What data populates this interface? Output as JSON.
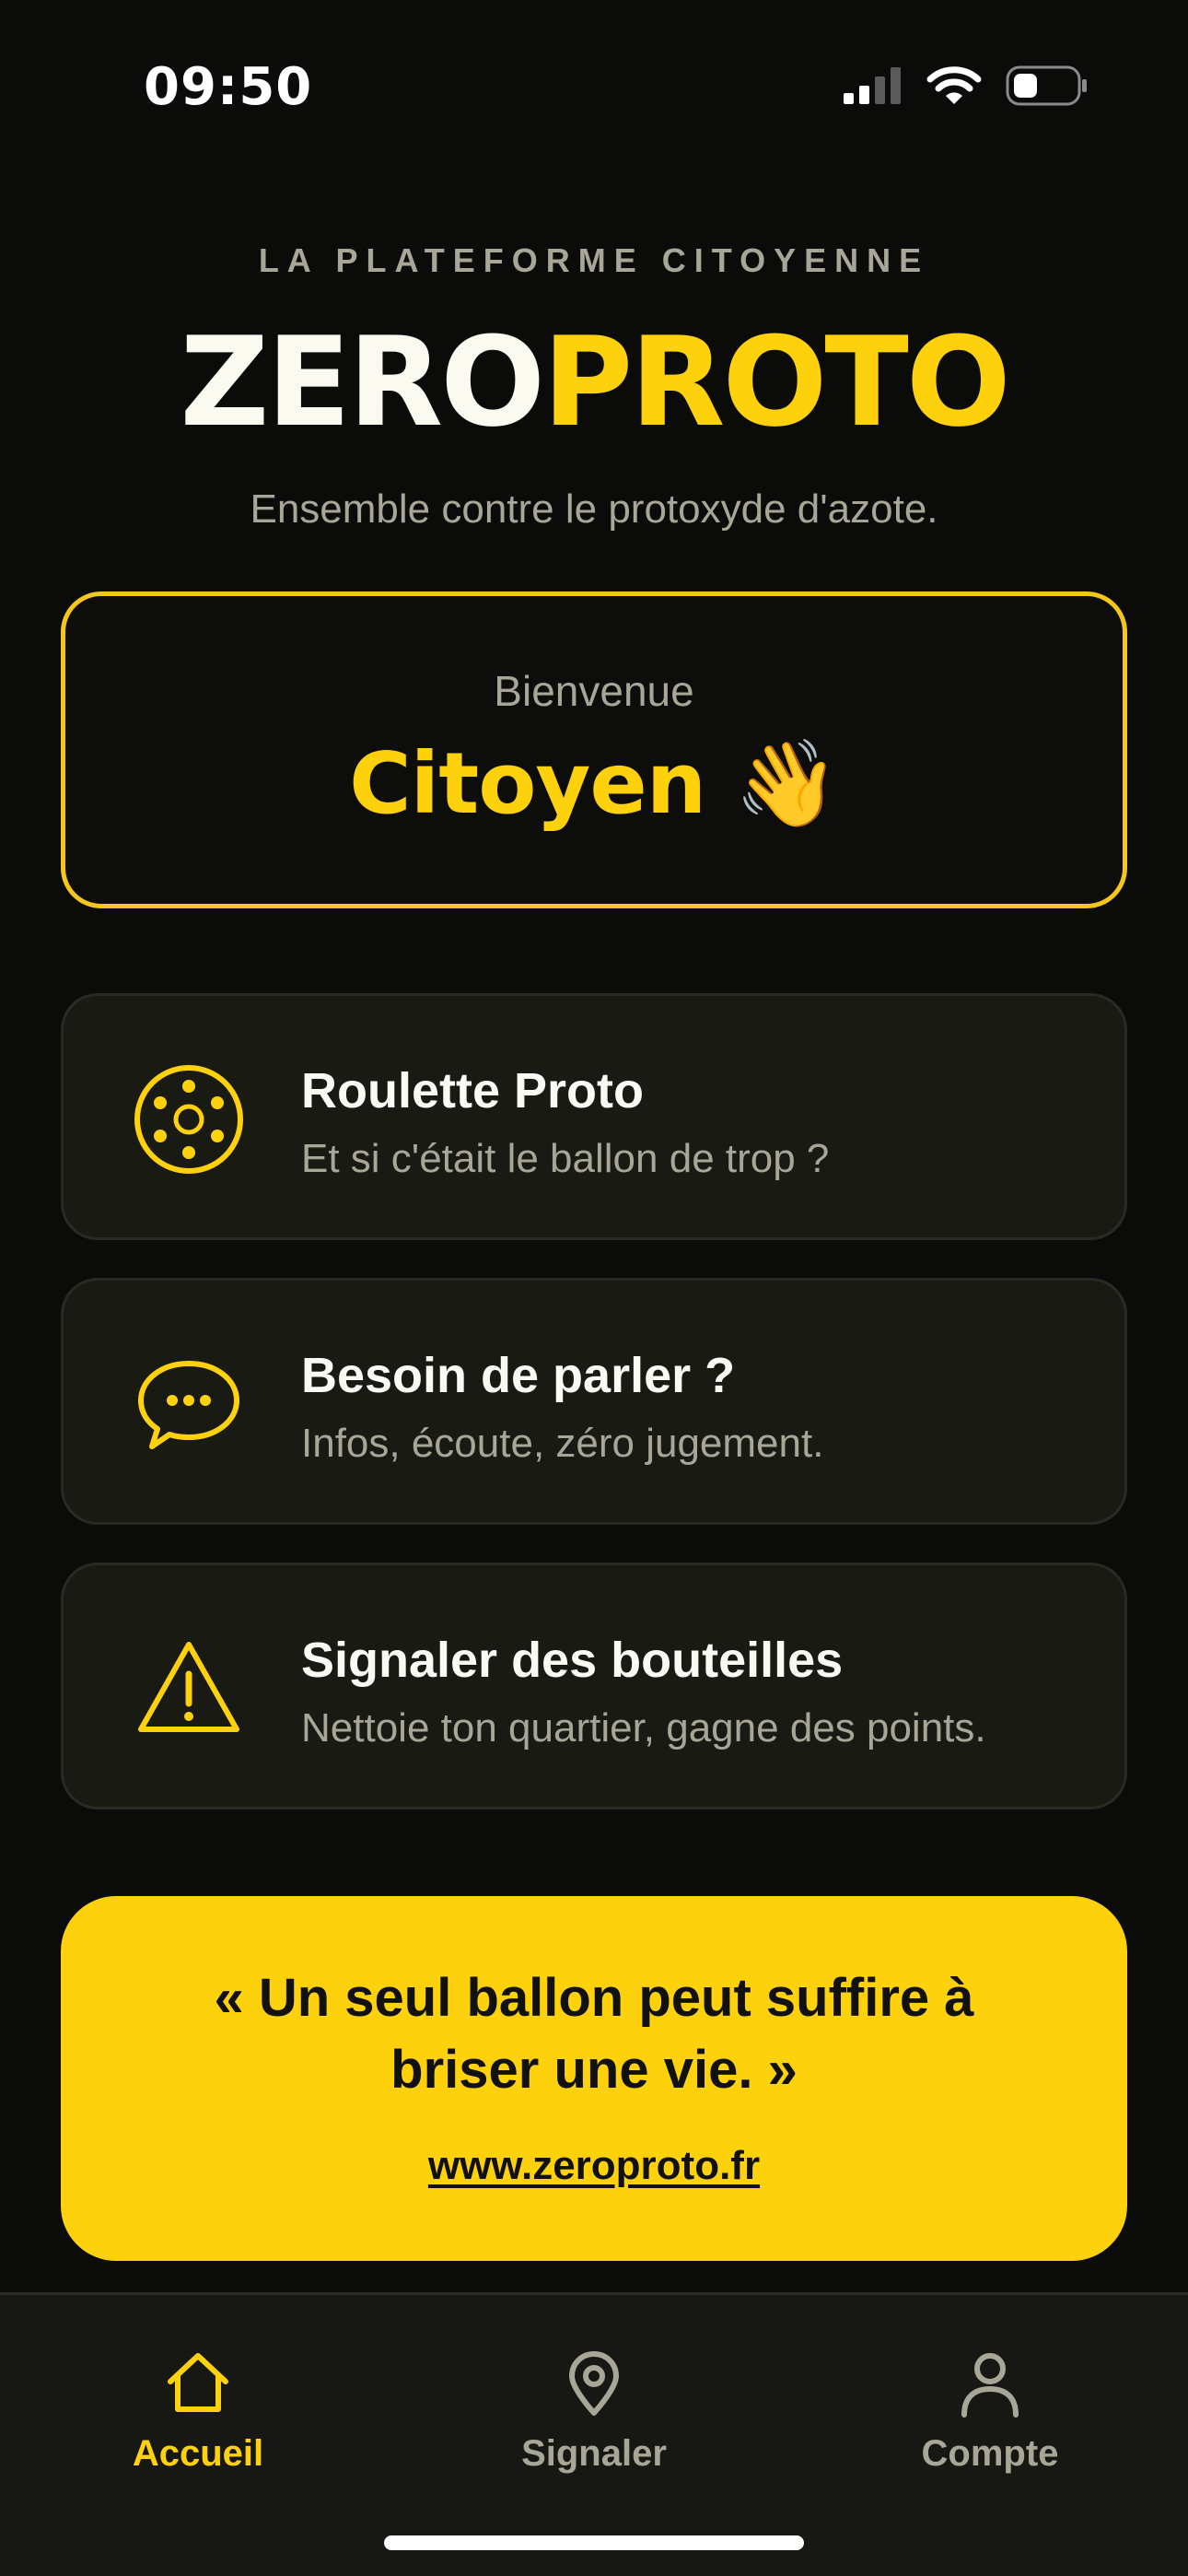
{
  "status_bar": {
    "time": "09:50"
  },
  "header": {
    "tagline": "LA PLATEFORME CITOYENNE",
    "logo_part1": "ZERO",
    "logo_part2": "PROTO",
    "subtitle": "Ensemble contre le protoxyde d'azote."
  },
  "welcome": {
    "label": "Bienvenue",
    "name": "Citoyen 👋"
  },
  "menu": [
    {
      "title": "Roulette Proto",
      "desc": "Et si c'était le ballon de trop ?",
      "icon": "roulette-icon"
    },
    {
      "title": "Besoin de parler ?",
      "desc": "Infos, écoute, zéro jugement.",
      "icon": "chat-bubble-icon"
    },
    {
      "title": "Signaler des bouteilles",
      "desc": "Nettoie ton quartier, gagne des points.",
      "icon": "warning-icon"
    }
  ],
  "quote": {
    "text": "« Un seul ballon peut suffire à briser une vie. »",
    "link": "www.zeroproto.fr"
  },
  "tabs": [
    {
      "label": "Accueil",
      "icon": "home-icon",
      "active": true
    },
    {
      "label": "Signaler",
      "icon": "location-pin-icon",
      "active": false
    },
    {
      "label": "Compte",
      "icon": "user-icon",
      "active": false
    }
  ],
  "colors": {
    "accent": "#fdd20c",
    "background": "#0b0b0a",
    "card": "#1a1a15",
    "muted": "#a8a697"
  }
}
